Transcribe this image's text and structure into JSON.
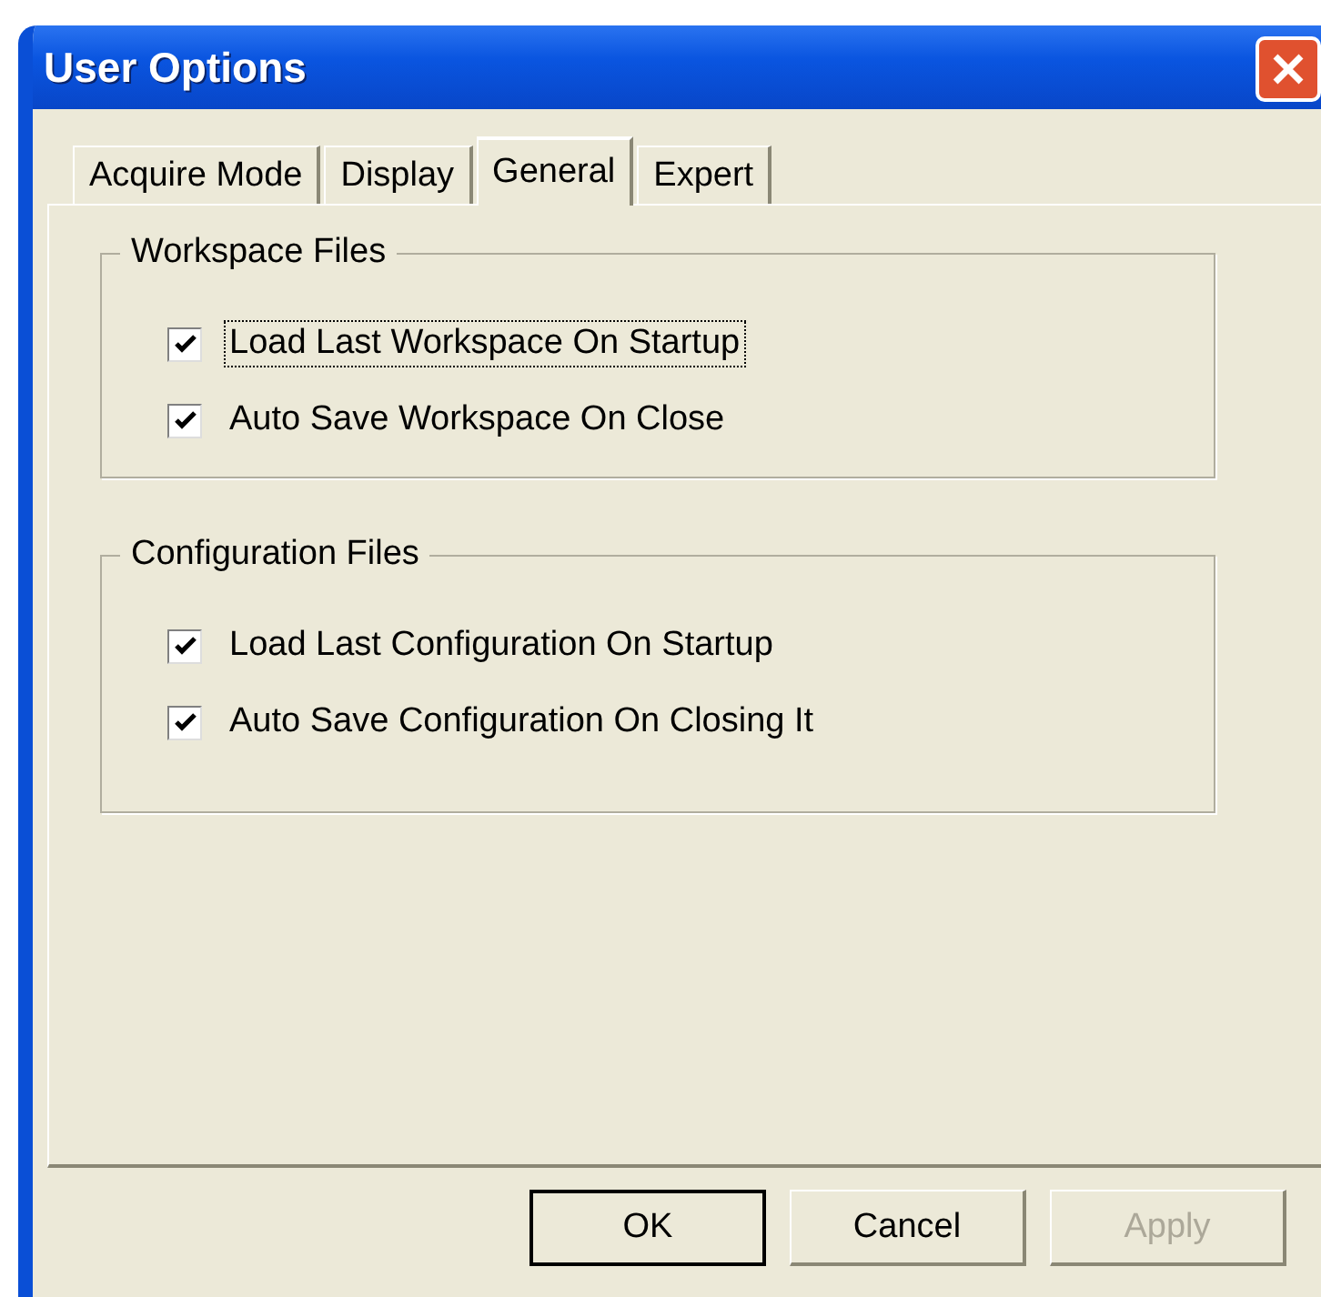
{
  "window": {
    "title": "User Options"
  },
  "tabs": [
    {
      "label": "Acquire Mode",
      "selected": false
    },
    {
      "label": "Display",
      "selected": false
    },
    {
      "label": "General",
      "selected": true
    },
    {
      "label": "Expert",
      "selected": false
    }
  ],
  "groups": [
    {
      "title": "Workspace Files",
      "options": [
        {
          "label": "Load Last Workspace On Startup",
          "checked": true,
          "focused": true
        },
        {
          "label": "Auto Save Workspace On Close",
          "checked": true,
          "focused": false
        }
      ]
    },
    {
      "title": "Configuration Files",
      "options": [
        {
          "label": "Load Last Configuration On Startup",
          "checked": true,
          "focused": false
        },
        {
          "label": "Auto Save Configuration On Closing It",
          "checked": true,
          "focused": false
        }
      ]
    }
  ],
  "buttons": [
    {
      "label": "OK",
      "default": true,
      "disabled": false
    },
    {
      "label": "Cancel",
      "default": false,
      "disabled": false
    },
    {
      "label": "Apply",
      "default": false,
      "disabled": true
    }
  ]
}
